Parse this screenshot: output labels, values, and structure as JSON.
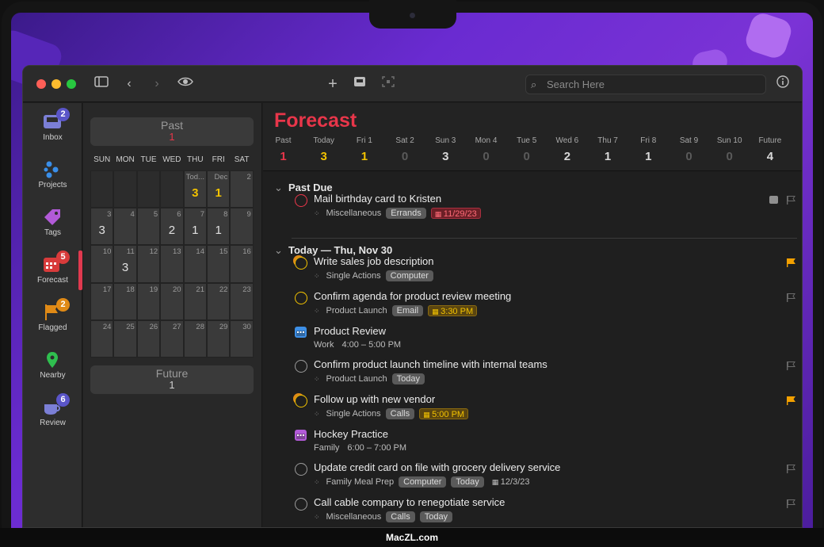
{
  "brand": "MacZL.com",
  "search": {
    "placeholder": "Search Here"
  },
  "sidebar": {
    "items": [
      {
        "label": "Inbox",
        "badge": "2",
        "badge_color": "#5a55c8"
      },
      {
        "label": "Projects"
      },
      {
        "label": "Tags"
      },
      {
        "label": "Forecast",
        "badge": "5",
        "badge_color": "#d83b3b"
      },
      {
        "label": "Flagged",
        "badge": "2",
        "badge_color": "#e08a16"
      },
      {
        "label": "Nearby"
      },
      {
        "label": "Review",
        "badge": "6",
        "badge_color": "#5a55c8"
      }
    ]
  },
  "calendar": {
    "past": {
      "label": "Past",
      "count": "1"
    },
    "future": {
      "label": "Future",
      "count": "1"
    },
    "weekdays": [
      "SUN",
      "MON",
      "TUE",
      "WED",
      "THU",
      "FRI",
      "SAT"
    ],
    "weeks": [
      [
        {
          "d": "",
          "c": ""
        },
        {
          "d": "",
          "c": ""
        },
        {
          "d": "",
          "c": ""
        },
        {
          "d": "",
          "c": ""
        },
        {
          "d": "Tod...",
          "c": "3",
          "hl": true
        },
        {
          "d": "Dec",
          "c": "1",
          "hl": true
        },
        {
          "d": "2",
          "c": ""
        }
      ],
      [
        {
          "d": "3",
          "c": "3"
        },
        {
          "d": "4",
          "c": ""
        },
        {
          "d": "5",
          "c": ""
        },
        {
          "d": "6",
          "c": "2"
        },
        {
          "d": "7",
          "c": "1"
        },
        {
          "d": "8",
          "c": "1"
        },
        {
          "d": "9",
          "c": ""
        }
      ],
      [
        {
          "d": "10",
          "c": ""
        },
        {
          "d": "11",
          "c": "3"
        },
        {
          "d": "12",
          "c": ""
        },
        {
          "d": "13",
          "c": ""
        },
        {
          "d": "14",
          "c": ""
        },
        {
          "d": "15",
          "c": ""
        },
        {
          "d": "16",
          "c": ""
        }
      ],
      [
        {
          "d": "17",
          "c": ""
        },
        {
          "d": "18",
          "c": ""
        },
        {
          "d": "19",
          "c": ""
        },
        {
          "d": "20",
          "c": ""
        },
        {
          "d": "21",
          "c": ""
        },
        {
          "d": "22",
          "c": ""
        },
        {
          "d": "23",
          "c": ""
        }
      ],
      [
        {
          "d": "24",
          "c": ""
        },
        {
          "d": "25",
          "c": ""
        },
        {
          "d": "26",
          "c": ""
        },
        {
          "d": "27",
          "c": ""
        },
        {
          "d": "28",
          "c": ""
        },
        {
          "d": "29",
          "c": ""
        },
        {
          "d": "30",
          "c": ""
        }
      ]
    ]
  },
  "forecast": {
    "title": "Forecast",
    "days": [
      {
        "label": "Past",
        "count": "1",
        "color": "#e8364a"
      },
      {
        "label": "Today",
        "count": "3",
        "color": "#f2c200"
      },
      {
        "label": "Fri 1",
        "count": "1",
        "color": "#f2c200"
      },
      {
        "label": "Sat 2",
        "count": "0",
        "color": "#5a5a5a"
      },
      {
        "label": "Sun 3",
        "count": "3",
        "color": "#d8d8d8"
      },
      {
        "label": "Mon 4",
        "count": "0",
        "color": "#5a5a5a"
      },
      {
        "label": "Tue 5",
        "count": "0",
        "color": "#5a5a5a"
      },
      {
        "label": "Wed 6",
        "count": "2",
        "color": "#d8d8d8"
      },
      {
        "label": "Thu 7",
        "count": "1",
        "color": "#d8d8d8"
      },
      {
        "label": "Fri 8",
        "count": "1",
        "color": "#d8d8d8"
      },
      {
        "label": "Sat 9",
        "count": "0",
        "color": "#5a5a5a"
      },
      {
        "label": "Sun 10",
        "count": "0",
        "color": "#5a5a5a"
      },
      {
        "label": "Future",
        "count": "4",
        "color": "#d8d8d8"
      }
    ]
  },
  "sections": [
    {
      "title": "Past Due"
    },
    {
      "title": "Today — Thu, Nov 30"
    }
  ],
  "tasks": [
    {
      "name": "Mail birthday card to Kristen",
      "project": "Miscellaneous",
      "tags": [
        "Errands"
      ],
      "due": "11/29/23",
      "due_style": "overdue",
      "check": "overdue",
      "flag": "none",
      "note": true
    },
    {
      "name": "Write sales job description",
      "project": "Single Actions",
      "tags": [
        "Computer"
      ],
      "due": "",
      "check": "today-flagged",
      "flag": "orange"
    },
    {
      "name": "Confirm agenda for product review meeting",
      "project": "Product Launch",
      "tags": [
        "Email"
      ],
      "due": "3:30 PM",
      "due_style": "soon",
      "check": "today",
      "flag": "none"
    },
    {
      "name": "Product Review",
      "project": "Work",
      "time": "4:00 – 5:00 PM",
      "type": "event",
      "event_color": "#3d8fe6"
    },
    {
      "name": "Confirm product launch timeline with internal teams",
      "project": "Product Launch",
      "tags": [
        "Today"
      ],
      "due": "",
      "check": "normal",
      "flag": "none"
    },
    {
      "name": "Follow up with new vendor",
      "project": "Single Actions",
      "tags": [
        "Calls"
      ],
      "due": "5:00 PM",
      "due_style": "soon",
      "check": "today-flagged",
      "flag": "orange"
    },
    {
      "name": "Hockey Practice",
      "project": "Family",
      "time": "6:00 – 7:00 PM",
      "type": "event",
      "event_color": "#b25ad8"
    },
    {
      "name": "Update credit card on file with grocery delivery service",
      "project": "Family Meal Prep",
      "tags": [
        "Computer",
        "Today"
      ],
      "due": "12/3/23",
      "due_style": "plain",
      "check": "normal",
      "flag": "none"
    },
    {
      "name": "Call cable company to renegotiate service",
      "project": "Miscellaneous",
      "tags": [
        "Calls",
        "Today"
      ],
      "due": "",
      "check": "normal",
      "flag": "none"
    }
  ]
}
